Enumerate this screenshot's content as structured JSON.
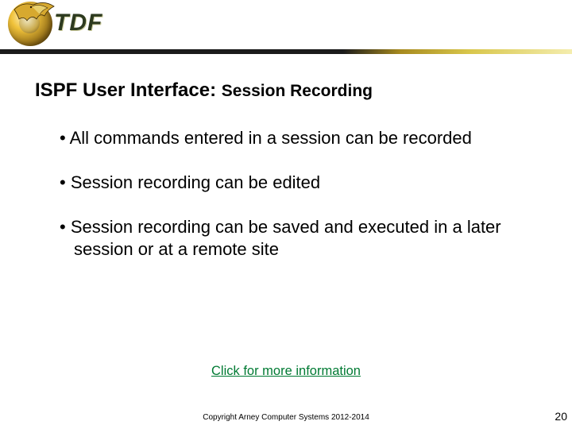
{
  "header": {
    "logo_text": "TDF"
  },
  "title": {
    "main": "ISPF User Interface:",
    "sub": "Session Recording"
  },
  "bullets": [
    "All commands entered in a session can be recorded",
    "Session recording can be edited",
    "Session recording can be saved and executed in a later session or at a remote site"
  ],
  "link": {
    "label": "Click for more information"
  },
  "footer": {
    "copyright": "Copyright Arney Computer Systems 2012-2014",
    "page": "20"
  }
}
